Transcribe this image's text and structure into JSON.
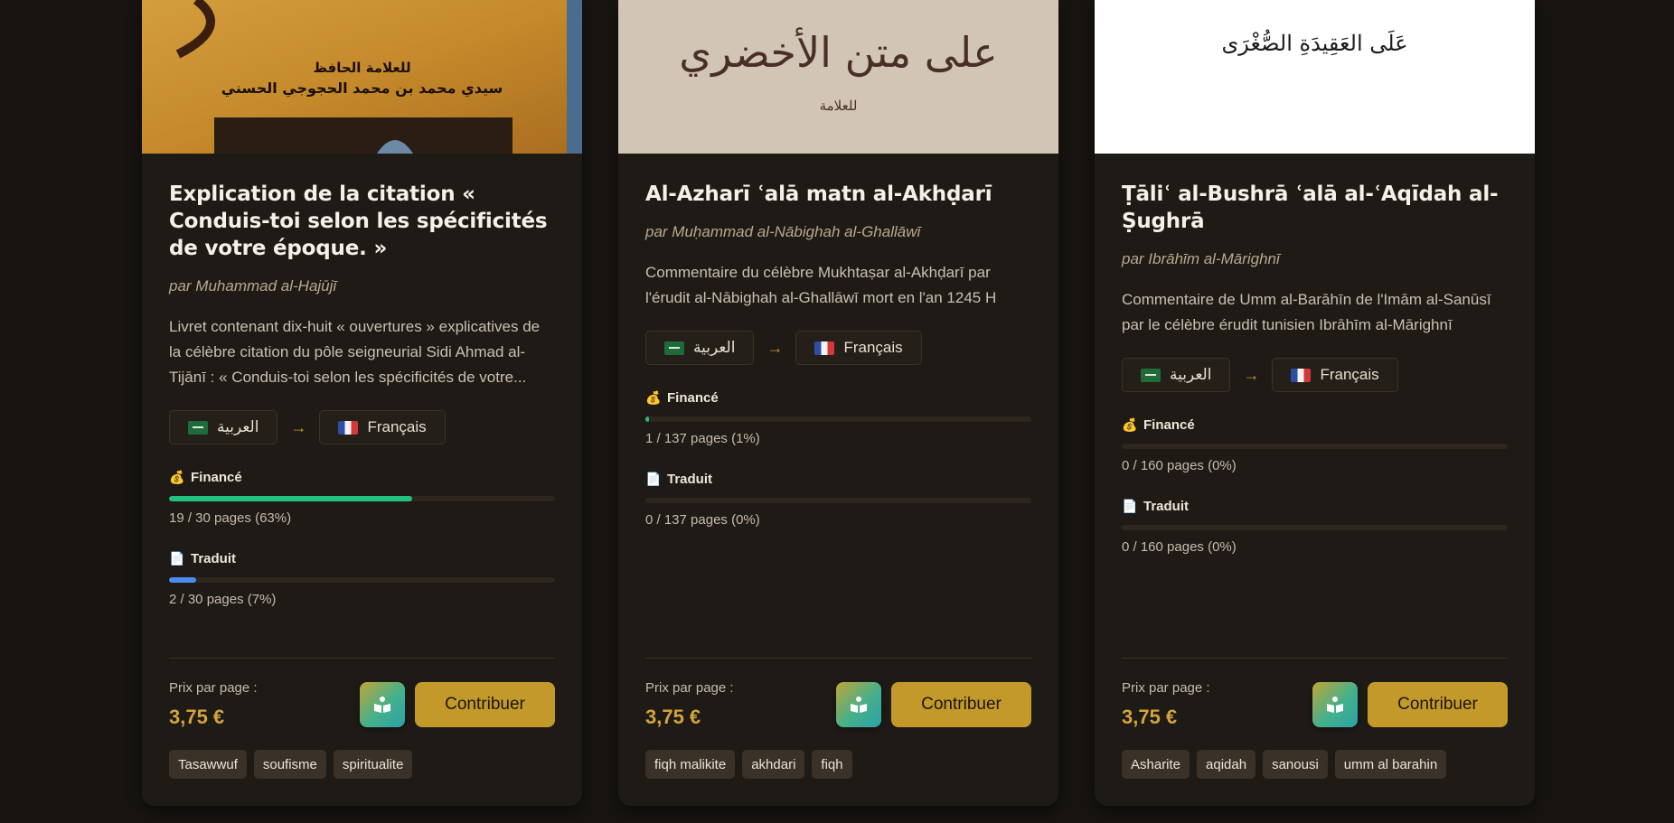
{
  "cards": [
    {
      "cover_arabic_lines": [
        "للعلامة الحافظ",
        "سيدي محمد بن محمد الحجوجي الحسني"
      ],
      "title": "Explication de la citation « Conduis-toi selon les spécificités de votre époque. »",
      "author": "par Muhammad al-Hajūjī",
      "description": "Livret contenant dix-huit « ouvertures » explicatives de la célèbre citation du pôle seigneurial Sidi Ahmad al-Tijānī : « Conduis-toi selon les spécificités de votre...",
      "lang_from": "العربية",
      "lang_to": "Français",
      "funded_label": "Financé",
      "funded_fraction": 0.63,
      "funded_count": "19 / 30 pages (63%)",
      "translated_label": "Traduit",
      "translated_fraction": 0.07,
      "translated_count": "2 / 30 pages (7%)",
      "price_label": "Prix par page :",
      "price": "3,75 €",
      "contribute_label": "Contribuer",
      "tags": [
        "Tasawwuf",
        "soufisme",
        "spiritualite"
      ]
    },
    {
      "cover_arabic_lines": [
        "على متن الأخضري",
        "للعلامة"
      ],
      "title": "Al-Azharī ʿalā matn al-Akhḍarī",
      "author": "par Muḥammad al-Nābighah al-Ghallāwī",
      "description": "Commentaire du célèbre Mukhtaṣar al-Akhḍarī par l'érudit al-Nābighah al-Ghallāwī mort en l'an 1245 H",
      "lang_from": "العربية",
      "lang_to": "Français",
      "funded_label": "Financé",
      "funded_fraction": 0.01,
      "funded_count": "1 / 137 pages (1%)",
      "translated_label": "Traduit",
      "translated_fraction": 0,
      "translated_count": "0 / 137 pages (0%)",
      "price_label": "Prix par page :",
      "price": "3,75 €",
      "contribute_label": "Contribuer",
      "tags": [
        "fiqh malikite",
        "akhdari",
        "fiqh"
      ]
    },
    {
      "cover_arabic_lines": [
        "عَلَى العَقِيدَةِ الصُّغْرَى"
      ],
      "title": "Ṭāliʿ al-Bushrā ʿalā al-ʿAqīdah al-Ṣughrā",
      "author": "par Ibrāhīm al-Mārighnī",
      "description": "Commentaire de Umm al-Barāhīn de l'Imām al-Sanūsī par le célèbre érudit tunisien Ibrāhīm al-Mārighnī",
      "lang_from": "العربية",
      "lang_to": "Français",
      "funded_label": "Financé",
      "funded_fraction": 0,
      "funded_count": "0 / 160 pages (0%)",
      "translated_label": "Traduit",
      "translated_fraction": 0,
      "translated_count": "0 / 160 pages (0%)",
      "price_label": "Prix par page :",
      "price": "3,75 €",
      "contribute_label": "Contribuer",
      "tags": [
        "Asharite",
        "aqidah",
        "sanousi",
        "umm al barahin"
      ]
    }
  ],
  "colors": {
    "funded_bar": "#22c17f",
    "translated_bar": "#4a8df0",
    "price": "#d3a43b",
    "contribute_button": "#c39a2a"
  },
  "icons": {
    "funded": "money-bag-icon",
    "translated": "document-icon",
    "read": "open-book-icon",
    "lang_from_flag": "saudi-flag-icon",
    "lang_to_flag": "french-flag-icon",
    "direction": "arrow-right-icon"
  }
}
